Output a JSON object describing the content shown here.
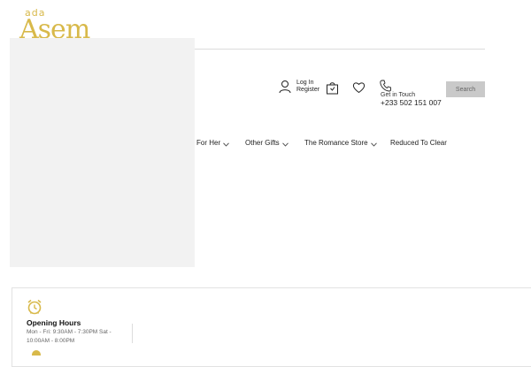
{
  "brand": {
    "logo_small": "ada",
    "logo_big": "Asem",
    "logo_color": "#d8b94a"
  },
  "header": {
    "login_label": "Log In",
    "register_label": "Register",
    "contact_label": "Get in Touch",
    "phone": "+233 502 151 007",
    "search_label": "Search",
    "icons": [
      "user-icon",
      "cart-icon",
      "heart-icon",
      "phone-icon"
    ]
  },
  "nav": {
    "items": [
      {
        "label": "For Her",
        "has_dropdown": true
      },
      {
        "label": "Other Gifts",
        "has_dropdown": true
      },
      {
        "label": "The Romance Store",
        "has_dropdown": true
      },
      {
        "label": "Reduced To Clear",
        "has_dropdown": false
      }
    ]
  },
  "info": {
    "hours_title": "Opening Hours",
    "hours_text": "Mon - Fri: 9:30AM - 7:30PM Sat - 10:00AM - 8:00PM",
    "icon": "alarm-clock-icon"
  }
}
